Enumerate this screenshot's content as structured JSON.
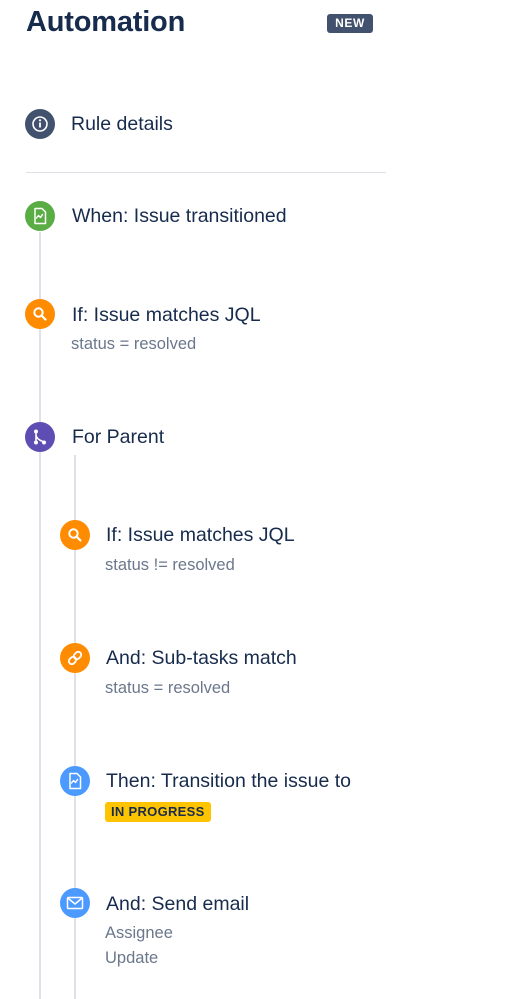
{
  "header": {
    "title": "Automation",
    "badge": "NEW"
  },
  "rule_details": {
    "label": "Rule details",
    "icon": "info-icon",
    "color": "#42526e"
  },
  "trigger": {
    "label": "When: Issue transitioned",
    "icon": "trigger-icon",
    "color": "#5aac44"
  },
  "condition_1": {
    "label": "If: Issue matches JQL",
    "detail": "status = resolved",
    "icon": "search-icon",
    "color": "#ff8b00"
  },
  "branch": {
    "label": "For Parent",
    "icon": "branch-icon",
    "color": "#5e4db2"
  },
  "nested": {
    "condition_jql": {
      "label": "If: Issue matches JQL",
      "detail": "status != resolved",
      "icon": "search-icon",
      "color": "#ff8b00"
    },
    "condition_subtasks": {
      "label": "And: Sub-tasks match",
      "detail": "status = resolved",
      "icon": "link-icon",
      "color": "#ff8b00"
    },
    "action_transition": {
      "label": "Then: Transition the issue to",
      "status": "IN PROGRESS",
      "status_color": "#ffc400",
      "icon": "transition-icon",
      "color": "#4c9aff"
    },
    "action_email": {
      "label": "And: Send email",
      "detail_1": "Assignee",
      "detail_2": "Update",
      "icon": "email-icon",
      "color": "#4c9aff"
    }
  }
}
